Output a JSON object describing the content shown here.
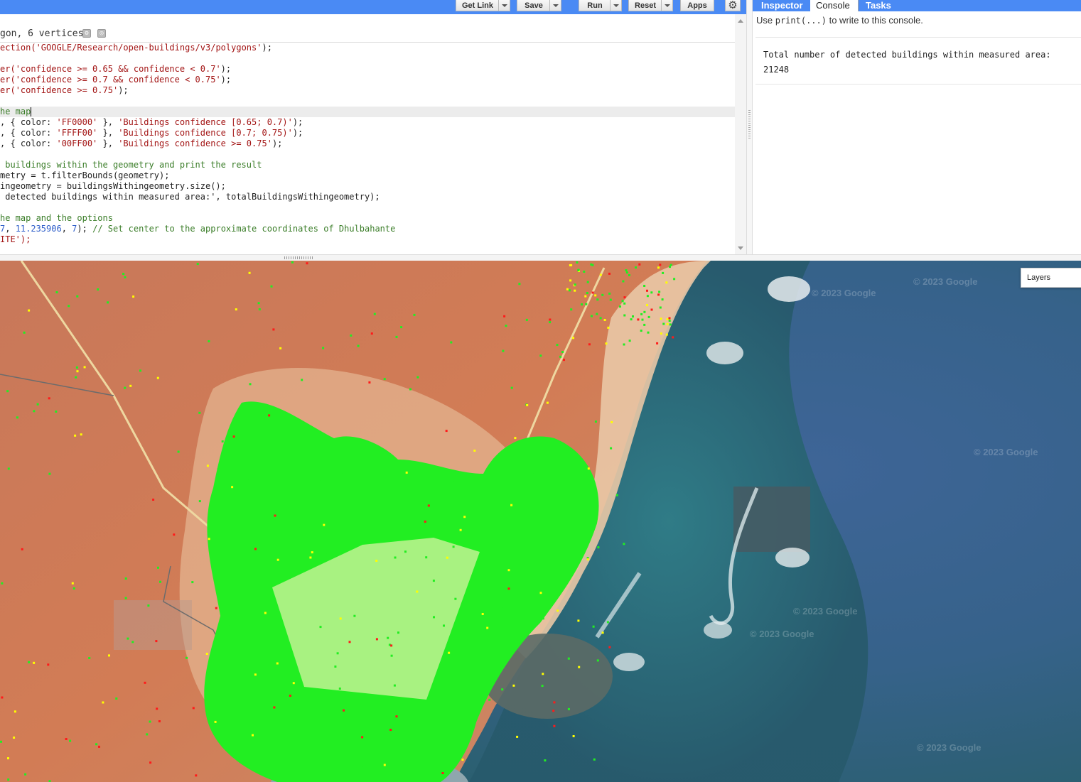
{
  "toolbar": {
    "get_link_label": "Get Link",
    "save_label": "Save",
    "run_label": "Run",
    "reset_label": "Reset",
    "apps_label": "Apps"
  },
  "editor": {
    "header_text": "gon, 6 vertices",
    "lines": [
      "ection('GOOGLE/Research/open-buildings/v3/polygons');",
      "",
      "er('confidence >= 0.65 && confidence < 0.7');",
      "er('confidence >= 0.7 && confidence < 0.75');",
      "er('confidence >= 0.75');",
      "",
      "he map",
      ", { color: 'FF0000' }, 'Buildings confidence [0.65; 0.7)');",
      ", { color: 'FFFF00' }, 'Buildings confidence [0.7; 0.75)');",
      ", { color: '00FF00' }, 'Buildings confidence >= 0.75');",
      "",
      " buildings within the geometry and print the result",
      "metry = t.filterBounds(geometry);",
      "ingeometry = buildingsWithingeometry.size();",
      " detected buildings within measured area:', totalBuildingsWithingeometry);",
      "",
      "he map and the options",
      "7, 11.235906, 7); // Set center to the approximate coordinates of Dhulbahante",
      "ITE');"
    ]
  },
  "tabs": {
    "inspector": "Inspector",
    "console": "Console",
    "tasks": "Tasks"
  },
  "console": {
    "hint_before": "Use ",
    "hint_code": "print(...)",
    "hint_after": " to write to this console.",
    "output_label": "Total number of detected buildings within measured area:",
    "output_value": "21248"
  },
  "map": {
    "layers_label": "Layers",
    "watermark": "© 2023 Google",
    "ocean_color": "#2f5d73",
    "land_color": "#d4825a",
    "building_color": "#22ee22",
    "polygon_fill": "#b4f28a"
  }
}
